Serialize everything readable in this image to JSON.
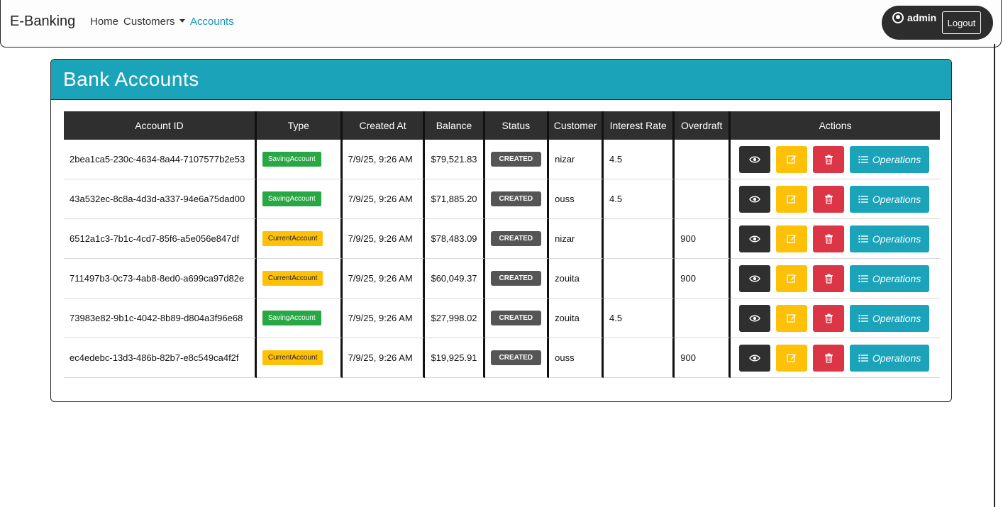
{
  "nav": {
    "brand": "E-Banking",
    "home": "Home",
    "customers": "Customers",
    "accounts": "Accounts",
    "user": "admin",
    "logout": "Logout"
  },
  "card": {
    "title": "Bank Accounts"
  },
  "table": {
    "headers": [
      "Account ID",
      "Type",
      "Created At",
      "Balance",
      "Status",
      "Customer",
      "Interest Rate",
      "Overdraft",
      "Actions"
    ],
    "operations_label": "Operations",
    "rows": [
      {
        "id": "2bea1ca5-230c-4634-8a44-7107577b2e53",
        "type": "SavingAccount",
        "created": "7/9/25, 9:26 AM",
        "balance": "$79,521.83",
        "status": "CREATED",
        "customer": "nizar",
        "interest": "4.5",
        "overdraft": ""
      },
      {
        "id": "43a532ec-8c8a-4d3d-a337-94e6a75dad00",
        "type": "SavingAccount",
        "created": "7/9/25, 9:26 AM",
        "balance": "$71,885.20",
        "status": "CREATED",
        "customer": "ouss",
        "interest": "4.5",
        "overdraft": ""
      },
      {
        "id": "6512a1c3-7b1c-4cd7-85f6-a5e056e847df",
        "type": "CurrentAccount",
        "created": "7/9/25, 9:26 AM",
        "balance": "$78,483.09",
        "status": "CREATED",
        "customer": "nizar",
        "interest": "",
        "overdraft": "900"
      },
      {
        "id": "711497b3-0c73-4ab8-8ed0-a699ca97d82e",
        "type": "CurrentAccount",
        "created": "7/9/25, 9:26 AM",
        "balance": "$60,049.37",
        "status": "CREATED",
        "customer": "zouita",
        "interest": "",
        "overdraft": "900"
      },
      {
        "id": "73983e82-9b1c-4042-8b89-d804a3f96e68",
        "type": "SavingAccount",
        "created": "7/9/25, 9:26 AM",
        "balance": "$27,998.02",
        "status": "CREATED",
        "customer": "zouita",
        "interest": "4.5",
        "overdraft": ""
      },
      {
        "id": "ec4edebc-13d3-486b-82b7-e8c549ca4f2f",
        "type": "CurrentAccount",
        "created": "7/9/25, 9:26 AM",
        "balance": "$19,925.91",
        "status": "CREATED",
        "customer": "ouss",
        "interest": "",
        "overdraft": "900"
      }
    ]
  },
  "colors": {
    "header": "#1aa3b9",
    "saving": "#28a745",
    "current": "#ffc107",
    "delete": "#dc3545",
    "dark": "#2f2f2f"
  },
  "icons": [
    "user-circle-icon",
    "eye-icon",
    "edit-icon",
    "trash-icon",
    "list-icon",
    "caret-down-icon"
  ]
}
